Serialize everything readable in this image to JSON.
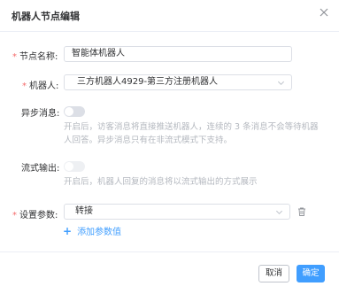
{
  "dialog": {
    "title": "机器人节点编辑"
  },
  "form": {
    "node_name": {
      "label": "节点名称:",
      "value": "智能体机器人"
    },
    "robot": {
      "label": "机器人:",
      "value": "三方机器人4929-第三方注册机器人"
    },
    "async_message": {
      "label": "异步消息:",
      "hint_line1": "开启后，访客消息将直接推送机器人，连续的 3 条消息不会等待机器",
      "hint_line2": "人回答。异步消息只有在非流式模式下支持。"
    },
    "stream_output": {
      "label": "流式输出:",
      "hint": "开启后，机器人回复的消息将以流式输出的方式展示"
    },
    "settings_params": {
      "label": "设置参数:",
      "value": "转接",
      "add_label": "添加参数值"
    }
  },
  "footer": {
    "cancel_label": "取消",
    "confirm_label": "确定"
  },
  "colors": {
    "primary": "#409eff",
    "required": "#f56c6c",
    "hint": "#b4b8bf"
  }
}
